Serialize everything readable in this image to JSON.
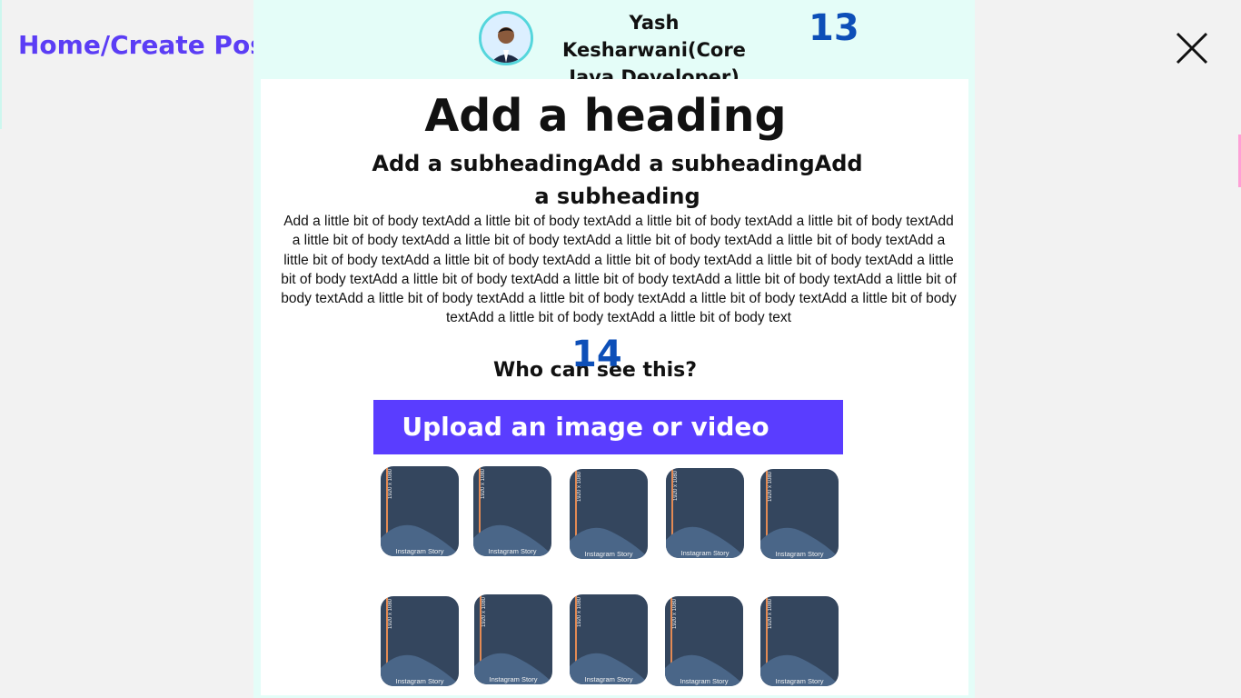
{
  "breadcrumb": "Home/Create Post",
  "user": {
    "name": "Yash Kesharwani(Core Java Developer)"
  },
  "markers": {
    "top": "13",
    "middle": "14"
  },
  "post": {
    "heading": "Add a heading",
    "subheading": "Add a subheadingAdd a subheadingAdd a subheading",
    "body": "Add a little bit of body textAdd a little bit of body textAdd a little bit of body textAdd a little bit of body textAdd a little bit of body textAdd a little bit of body textAdd a little bit of body textAdd a little bit of body textAdd a little bit of body textAdd a little bit of body textAdd a little bit of body textAdd a little bit of body textAdd a little bit of body textAdd a little bit of body textAdd a little bit of body textAdd a little bit of body textAdd a little bit of body textAdd a little bit of body textAdd a little bit of body textAdd a little bit of body textAdd a little bit of body textAdd a little bit of body textAdd a little bit of body text",
    "audience_label": "Who can see this?",
    "upload_label": "Upload an image or video"
  },
  "templates": {
    "size_label": "1920 x 1080",
    "items": [
      {
        "label": "Instagram Story"
      },
      {
        "label": "Instagram Story"
      },
      {
        "label": "Instagram Story"
      },
      {
        "label": "Instagram Story"
      },
      {
        "label": "Instagram Story"
      },
      {
        "label": "Instagram Story"
      },
      {
        "label": "Instagram Story"
      },
      {
        "label": "Instagram Story"
      },
      {
        "label": "Instagram Story"
      },
      {
        "label": "Instagram Story"
      }
    ]
  },
  "colors": {
    "accent": "#5a3dff",
    "panel": "#e4fdf8",
    "marker": "#0d4fb8",
    "thumb": "#34465e"
  },
  "icons": {
    "close": "close-icon",
    "avatar": "avatar"
  }
}
